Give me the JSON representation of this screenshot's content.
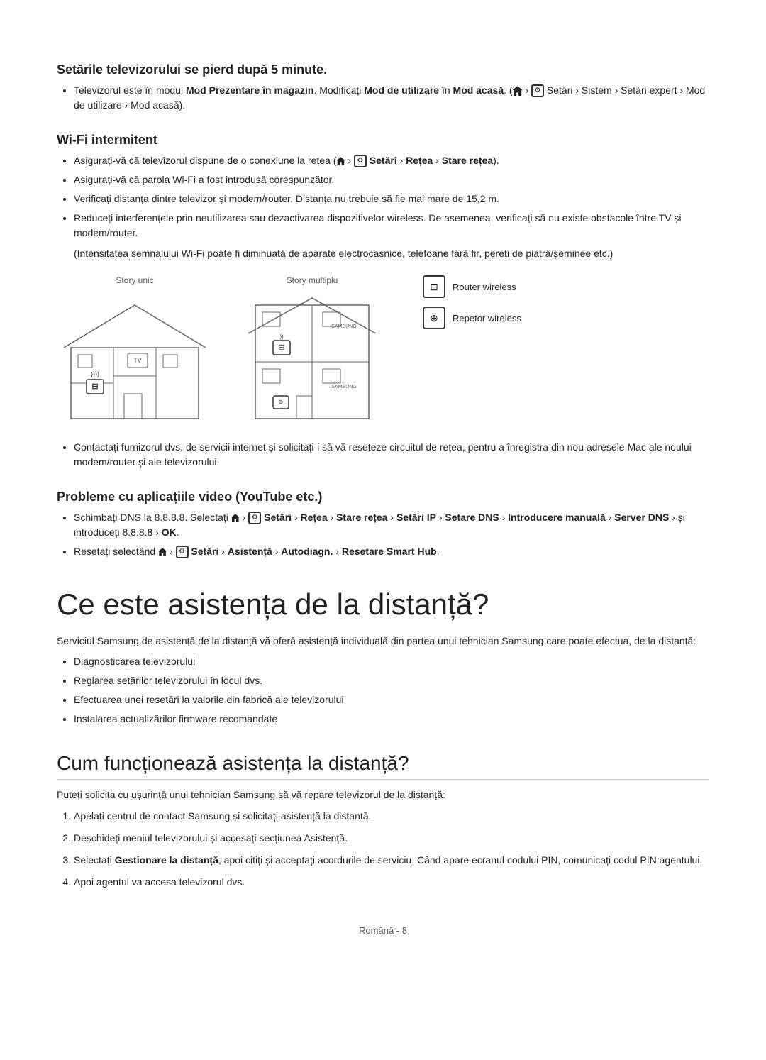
{
  "sections": {
    "section1": {
      "heading": "Setările televizorului se pierd după 5 minute.",
      "bullets": [
        {
          "text_before": "Televizorul este în modul ",
          "bold1": "Mod Prezentare în magazin",
          "text_mid1": ". Modificați ",
          "bold2": "Mod de utilizare",
          "text_mid2": " în ",
          "bold3": "Mod acasă",
          "text_mid3": ". (",
          "icon_home": true,
          "text_after1": " › ",
          "icon_gear": true,
          "text_after2": " Setări › Sistem › Setări expert › Mod de utilizare › Mod acasă)."
        }
      ]
    },
    "section2": {
      "heading": "Wi-Fi intermitent",
      "bullets": [
        "Asigurați-vă că televizorul dispune de o conexiune la rețea (⌂ › ⚙ Setări › Rețea › Stare rețea).",
        "Asigurați-vă că parola Wi-Fi a fost introdusă corespunzător.",
        "Verificați distanța dintre televizor și modem/router. Distanța nu trebuie să fie mai mare de 15,2 m.",
        "Reduceți interferențele prin neutilizarea sau dezactivarea dispozitivelor wireless. De asemenea, verificați să nu existe obstacole între TV și modem/router."
      ],
      "indent_note": "(Intensitatea semnalului Wi-Fi poate fi diminuată de aparate electrocasnice, telefoane fără fir, pereți de piatră/șeminee etc.)",
      "diagram_label_single": "Story unic",
      "diagram_label_multi": "Story multiplu",
      "legend": [
        {
          "icon": "router",
          "label": "Router wireless"
        },
        {
          "icon": "repeater",
          "label": "Repetor wireless"
        }
      ],
      "contact_bullet": "Contactați furnizorul dvs. de servicii internet și solicitați-i să vă reseteze circuitul de rețea, pentru a înregistra din nou adresele Mac ale noului modem/router și ale televizorului."
    },
    "section3": {
      "heading": "Probleme cu aplicațiile video (YouTube etc.)",
      "bullets": [
        "Schimbați DNS la 8.8.8.8. Selectați ⌂ › ⚙ Setări › Rețea › Stare rețea › Setări IP › Setare DNS › Introducere manuală › Server DNS › și introduceți 8.8.8.8 › OK.",
        "Resetați selectând ⌂ › ⚙ Setări › Asistență › Autodiagn. › Resetare Smart Hub."
      ]
    },
    "main_heading": "Ce este asistența de la distanță?",
    "main_intro": "Serviciul Samsung de asistență de la distanță vă oferă asistență individuală din partea unui tehnician Samsung care poate efectua, de la distanță:",
    "main_bullets": [
      "Diagnosticarea televizorului",
      "Reglarea setărilor televizorului în locul dvs.",
      "Efectuarea unei resetări la valorile din fabrică ale televizorului",
      "Instalarea actualizărilor firmware recomandate"
    ],
    "sub_heading": "Cum funcționează asistența la distanță?",
    "sub_intro": "Puteți solicita cu ușurință unui tehnician Samsung să vă repare televizorul de la distanță:",
    "numbered_items": [
      "Apelați centrul de contact Samsung și solicitați asistență la distanță.",
      "Deschideți meniul televizorului și accesați secțiunea Asistență.",
      "Selectați Gestionare la distanță, apoi citiți și acceptați acordurile de serviciu. Când apare ecranul codului PIN, comunicați codul PIN agentului.",
      "Apoi agentul va accesa televizorul dvs."
    ],
    "footer": "Română - 8"
  }
}
